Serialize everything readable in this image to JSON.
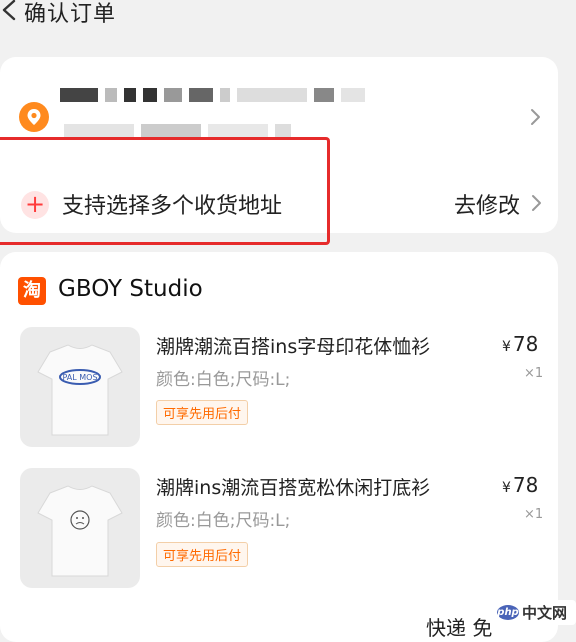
{
  "header": {
    "title": "确认订单"
  },
  "address": {
    "multi_address_label": "支持选择多个收货地址",
    "edit_label": "去修改",
    "accent_color": "#ff8a1e",
    "highlight_color": "#e62b2b"
  },
  "shop": {
    "icon_text": "淘",
    "name": "GBOY Studio"
  },
  "products": [
    {
      "title": "潮牌潮流百搭ins字母印花体恤衫",
      "spec": "颜色:白色;尺码:L;",
      "badge": "可享先用后付",
      "currency": "¥",
      "price": "78",
      "qty": "×1"
    },
    {
      "title": "潮牌ins潮流百搭宽松休闲打底衫",
      "spec": "颜色:白色;尺码:L;",
      "badge": "可享先用后付",
      "currency": "¥",
      "price": "78",
      "qty": "×1"
    }
  ],
  "footer": {
    "partial_text": "快递 免"
  },
  "watermark": {
    "logo": "php",
    "text": "中文网"
  }
}
